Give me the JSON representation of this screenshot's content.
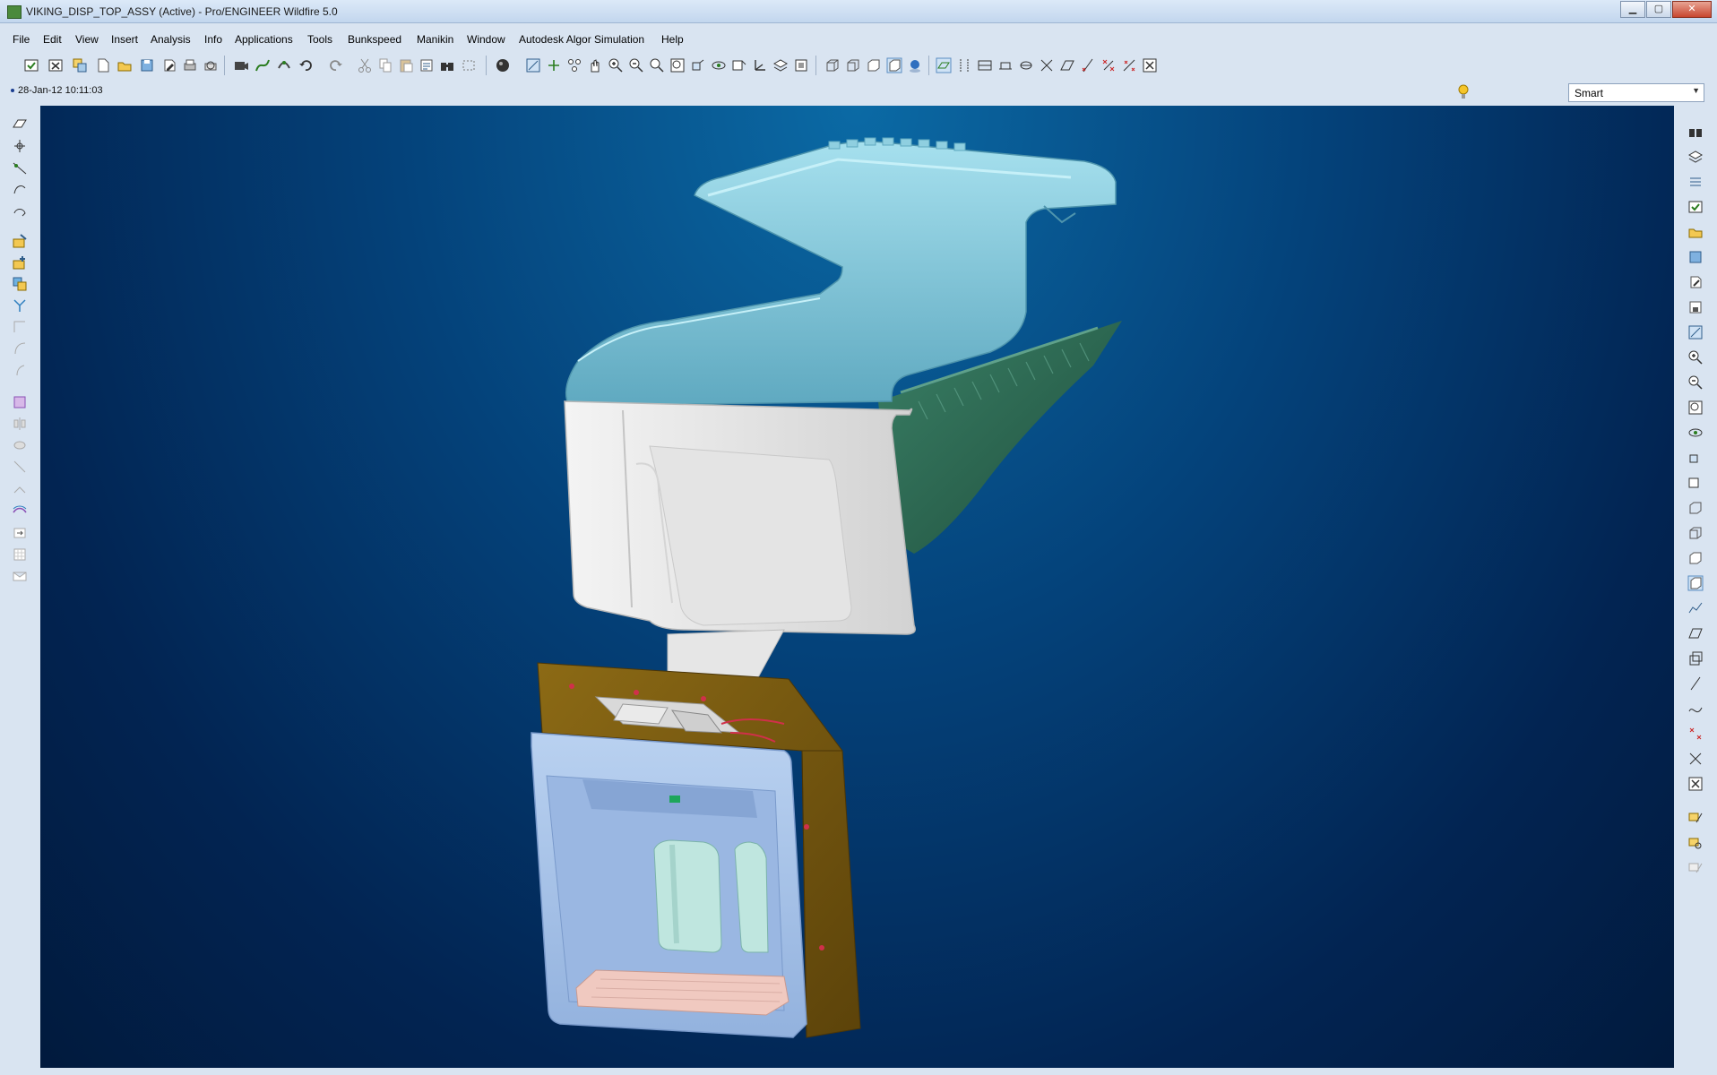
{
  "window": {
    "title": "VIKING_DISP_TOP_ASSY (Active) - Pro/ENGINEER Wildfire 5.0",
    "buttons": {
      "minimize": "▁",
      "maximize": "▢",
      "close": "✕"
    }
  },
  "menu": [
    "File",
    "Edit",
    "View",
    "Insert",
    "Analysis",
    "Info",
    "Applications",
    "Tools",
    "Bunkspeed",
    "Manikin",
    "Window",
    "Autodesk Algor Simulation",
    "Help"
  ],
  "toolbar_icons": [
    "regenerate-icon",
    "erase-icon",
    "window-activate-icon",
    "new-icon",
    "open-icon",
    "save-icon",
    "save-copy-icon",
    "print-icon",
    "print-preview-icon",
    "animation-icon",
    "curve-icon",
    "bolt-icon",
    "undo-icon",
    "redo-icon",
    "cut-icon",
    "copy-icon",
    "paste-icon",
    "paste-special-icon",
    "find-icon",
    "select-box-icon",
    "shading-sphere-icon",
    "sketch-view-icon",
    "datum-axis-icon",
    "network-icon",
    "pan-icon",
    "zoom-in-icon",
    "zoom-out-icon",
    "zoom-area-icon",
    "refit-icon",
    "reorient-icon",
    "spin-center-icon",
    "view-manager-icon",
    "csys-icon",
    "layers-icon",
    "model-tree-icon",
    "wireframe-icon",
    "hidden-line-icon",
    "no-hidden-icon",
    "shading-icon",
    "enhanced-realism-icon",
    "datum-planes-icon",
    "datum-axes-icon",
    "datum-points-icon",
    "datum-csys-icon",
    "annotation-icon",
    "plane-sketch-icon",
    "sketch-curve-icon",
    "point-x-icon",
    "point-pattern-icon",
    "close-window-icon"
  ],
  "status": {
    "datestamp": "28-Jan-12 10:11:03"
  },
  "filter": {
    "value": "Smart"
  },
  "colors": {
    "viewport_top": "#0b6aa5",
    "viewport_bottom": "#011a3d",
    "top_housing": "#7fc4d6",
    "chute": "#2f6a52",
    "white_part": "#ececec",
    "frame": "#7a5c10",
    "recess": "#a8c3e6",
    "drip_tray": "#f0c9c0"
  }
}
